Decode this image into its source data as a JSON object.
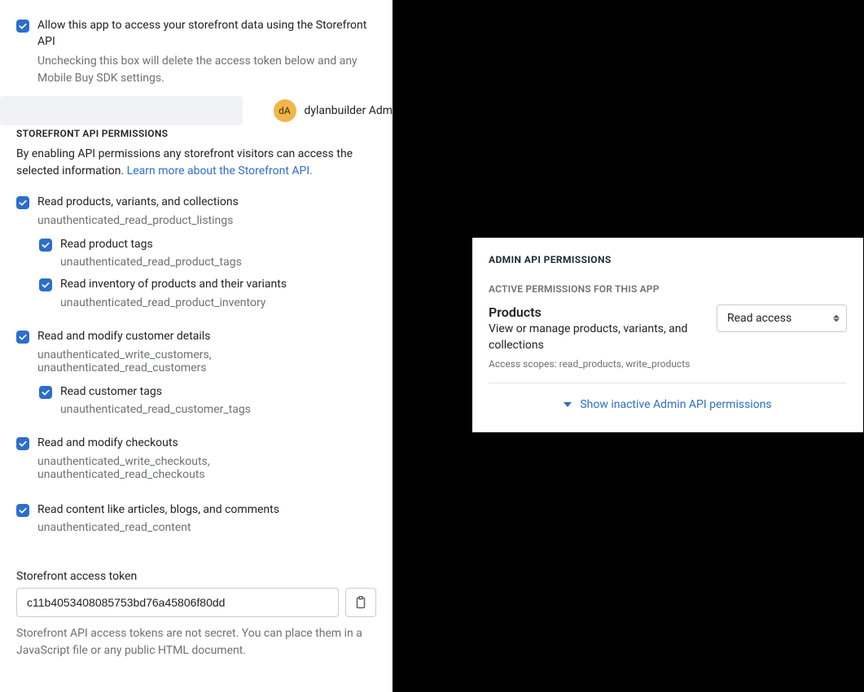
{
  "user": {
    "initials": "dA",
    "name": "dylanbuilder Adm"
  },
  "allow": {
    "label": "Allow this app to access your storefront data using the Storefront API",
    "desc": "Unchecking this box will delete the access token below and any Mobile Buy SDK settings."
  },
  "storefront": {
    "heading": "STOREFRONT API PERMISSIONS",
    "desc": "By enabling API permissions any storefront visitors can access the selected information. ",
    "link": "Learn more about the Storefront API.",
    "perms": [
      {
        "label": "Read products, variants, and collections",
        "scope": "unauthenticated_read_product_listings",
        "children": [
          {
            "label": "Read product tags",
            "scope": "unauthenticated_read_product_tags"
          },
          {
            "label": "Read inventory of products and their variants",
            "scope": "unauthenticated_read_product_inventory"
          }
        ]
      },
      {
        "label": "Read and modify customer details",
        "scope": "unauthenticated_write_customers, unauthenticated_read_customers",
        "children": [
          {
            "label": "Read customer tags",
            "scope": "unauthenticated_read_customer_tags"
          }
        ]
      },
      {
        "label": "Read and modify checkouts",
        "scope": "unauthenticated_write_checkouts, unauthenticated_read_checkouts",
        "children": []
      },
      {
        "label": "Read content like articles, blogs, and comments",
        "scope": "unauthenticated_read_content",
        "children": []
      }
    ],
    "token_label": "Storefront access token",
    "token_value": "c11b4053408085753bd76a45806f80dd",
    "token_help": "Storefront API access tokens are not secret. You can place them in a JavaScript file or any public HTML document."
  },
  "admin": {
    "heading": "ADMIN API PERMISSIONS",
    "subheading": "ACTIVE PERMISSIONS FOR THIS APP",
    "perm": {
      "title": "Products",
      "desc": "View or manage products, variants, and collections",
      "scopes": "Access scopes: read_products, write_products",
      "select": "Read access"
    },
    "show_inactive": "Show inactive Admin API permissions"
  }
}
